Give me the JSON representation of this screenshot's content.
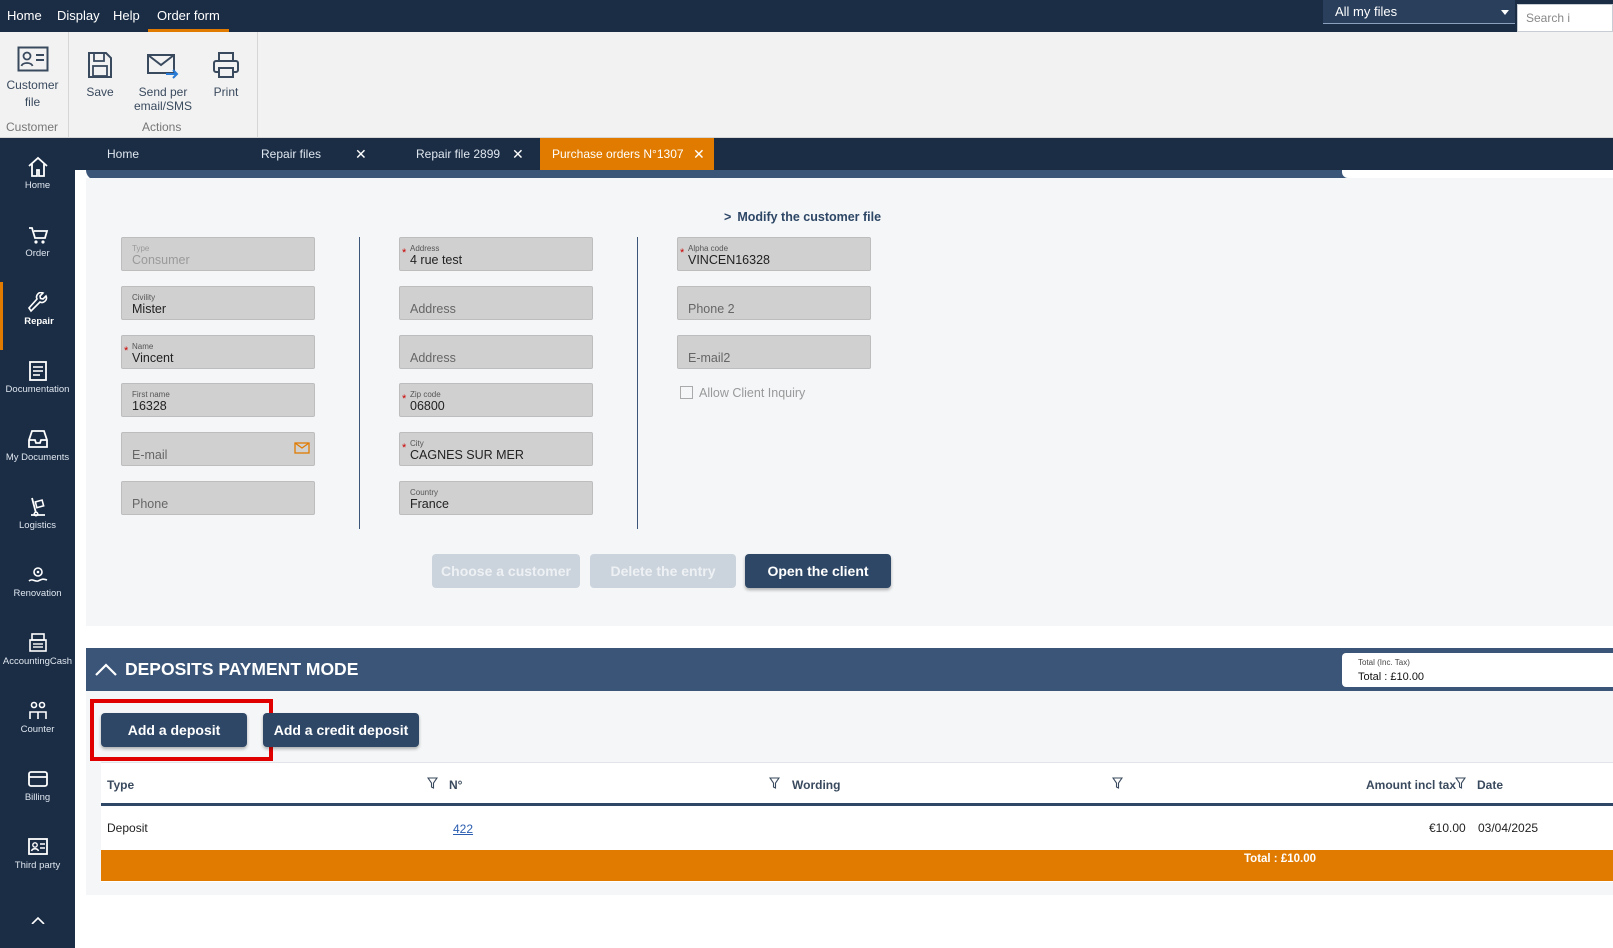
{
  "menubar": {
    "items": [
      "Home",
      "Display",
      "Help",
      "Order form"
    ],
    "file_selector": "All my files",
    "search_placeholder": "Search i"
  },
  "ribbon": {
    "customer_file": [
      "Customer",
      "file"
    ],
    "customer_group": "Customer",
    "save": "Save",
    "send": [
      "Send per",
      "email/SMS"
    ],
    "print": "Print",
    "actions_group": "Actions"
  },
  "sidebar": {
    "items": [
      {
        "label": "Home",
        "icon": "home-icon"
      },
      {
        "label": "Order",
        "icon": "cart-icon"
      },
      {
        "label": "Repair",
        "icon": "wrench-icon"
      },
      {
        "label": "Documentation",
        "icon": "document-icon"
      },
      {
        "label": "My Documents",
        "icon": "inbox-icon"
      },
      {
        "label": "Logistics",
        "icon": "dolly-icon"
      },
      {
        "label": "Renovation",
        "icon": "renovation-icon"
      },
      {
        "label": "AccountingCash",
        "icon": "cash-register-icon"
      },
      {
        "label": "Counter",
        "icon": "people-icon"
      },
      {
        "label": "Billing",
        "icon": "card-icon"
      },
      {
        "label": "Third party",
        "icon": "id-card-icon"
      }
    ],
    "active": "Repair"
  },
  "tabs": [
    {
      "label": "Home",
      "closable": false
    },
    {
      "label": "Repair files",
      "closable": true
    },
    {
      "label": "Repair file 2899",
      "closable": true
    },
    {
      "label": "Purchase orders N°1307",
      "closable": true,
      "active": true
    }
  ],
  "customer": {
    "modify_link": "Modify the customer file",
    "col1": [
      {
        "label": "Type",
        "value": "Consumer",
        "disabled": true
      },
      {
        "label": "Civility",
        "value": "Mister"
      },
      {
        "label": "Name",
        "value": "Vincent",
        "required": true
      },
      {
        "label": "First name",
        "value": "16328"
      },
      {
        "placeholder": "E-mail",
        "icon": "mail-icon"
      },
      {
        "placeholder": "Phone"
      }
    ],
    "col2": [
      {
        "label": "Address",
        "value": "4 rue test",
        "required": true
      },
      {
        "placeholder": "Address"
      },
      {
        "placeholder": "Address"
      },
      {
        "label": "Zip code",
        "value": "06800",
        "required": true
      },
      {
        "label": "City",
        "value": "CAGNES SUR MER",
        "required": true
      },
      {
        "label": "Country",
        "value": "France"
      }
    ],
    "col3": [
      {
        "label": "Alpha code",
        "value": "VINCEN16328",
        "required": true
      },
      {
        "placeholder": "Phone 2"
      },
      {
        "placeholder": "E-mail2"
      }
    ],
    "allow_inquiry": "Allow Client Inquiry",
    "buttons": {
      "choose": "Choose a customer",
      "delete": "Delete the entry",
      "open": "Open the client"
    }
  },
  "deposits": {
    "title": "DEPOSITS PAYMENT MODE",
    "total_label": "Total (Inc. Tax)",
    "total_value": "Total : £10.00",
    "add_deposit": "Add a deposit",
    "add_credit": "Add a credit deposit",
    "columns": [
      "Type",
      "N°",
      "Wording",
      "Amount incl tax",
      "Date"
    ],
    "rows": [
      {
        "type": "Deposit",
        "number": "422",
        "wording": "",
        "amount": "€10.00",
        "date": "03/04/2025"
      }
    ],
    "footer_total": "Total : £10.00"
  },
  "colors": {
    "navy": "#1b2d45",
    "accent": "#e07b00",
    "header": "#3a5577",
    "highlight": "#e00000"
  }
}
